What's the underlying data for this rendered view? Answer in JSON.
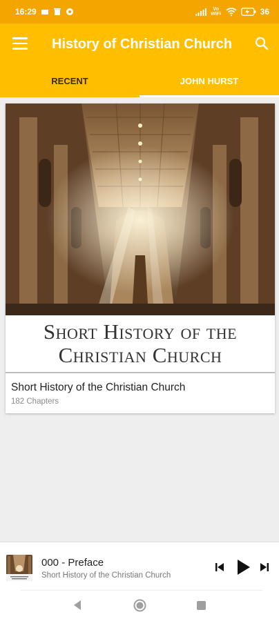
{
  "status_bar": {
    "time": "16:29",
    "network": "Vo WiFi",
    "battery": "36"
  },
  "app_bar": {
    "title": "History of Christian Church",
    "menu_icon": "menu-icon",
    "search_icon": "search-icon"
  },
  "tabs": [
    {
      "label": "RECENT",
      "active": false
    },
    {
      "label": "JOHN HURST",
      "active": true
    }
  ],
  "book": {
    "cover_line_1": "Short History of the",
    "cover_line_2": "Christian Church",
    "title": "Short History of the Christian Church",
    "chapters": "182 Chapters"
  },
  "player": {
    "track_title": "000 - Preface",
    "book_title": "Short History of the Christian Church",
    "controls": [
      "skip-previous-icon",
      "play-icon",
      "skip-next-icon"
    ]
  },
  "colors": {
    "primary": "#ffbf00",
    "status_bar": "#f5a500",
    "background": "#eeeeee"
  }
}
